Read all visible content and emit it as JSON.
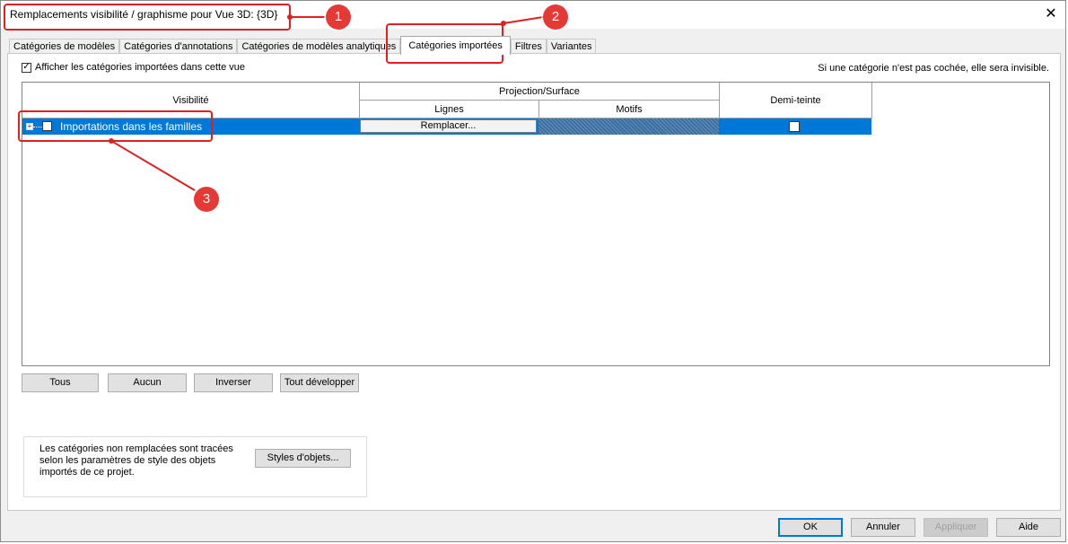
{
  "window": {
    "title": "Remplacements visibilité / graphisme pour Vue 3D: {3D}",
    "close_glyph": "✕"
  },
  "tabs": [
    {
      "label": "Catégories de modèles",
      "active": false
    },
    {
      "label": "Catégories d'annotations",
      "active": false
    },
    {
      "label": "Catégories de modèles analytiques",
      "active": false
    },
    {
      "label": "Catégories importées",
      "active": true
    },
    {
      "label": "Filtres",
      "active": false
    },
    {
      "label": "Variantes",
      "active": false
    }
  ],
  "panel": {
    "show_imported_label": "Afficher les catégories importées dans cette vue",
    "show_imported_checked": true,
    "hint": "Si une catégorie n'est pas cochée, elle sera invisible."
  },
  "grid": {
    "headers": {
      "visibility": "Visibilité",
      "projection_surface": "Projection/Surface",
      "lines": "Lignes",
      "patterns": "Motifs",
      "halftone": "Demi-teinte"
    },
    "rows": [
      {
        "expand_glyph": "+",
        "label": "Importations dans les familles",
        "visible_checked": false,
        "lines_button": "Remplacer...",
        "halftone_checked": false,
        "selected": true
      }
    ]
  },
  "buttons": {
    "all": "Tous",
    "none": "Aucun",
    "invert": "Inverser",
    "expand_all": "Tout développer",
    "object_styles": "Styles d'objets...",
    "ok": "OK",
    "cancel": "Annuler",
    "apply": "Appliquer",
    "help": "Aide"
  },
  "info_text": "Les catégories non remplacées sont tracées selon les paramètres de style des objets importés de ce projet.",
  "annotations": [
    "1",
    "2",
    "3"
  ],
  "colors": {
    "selection": "#0078d7",
    "annotation": "#e53935"
  }
}
